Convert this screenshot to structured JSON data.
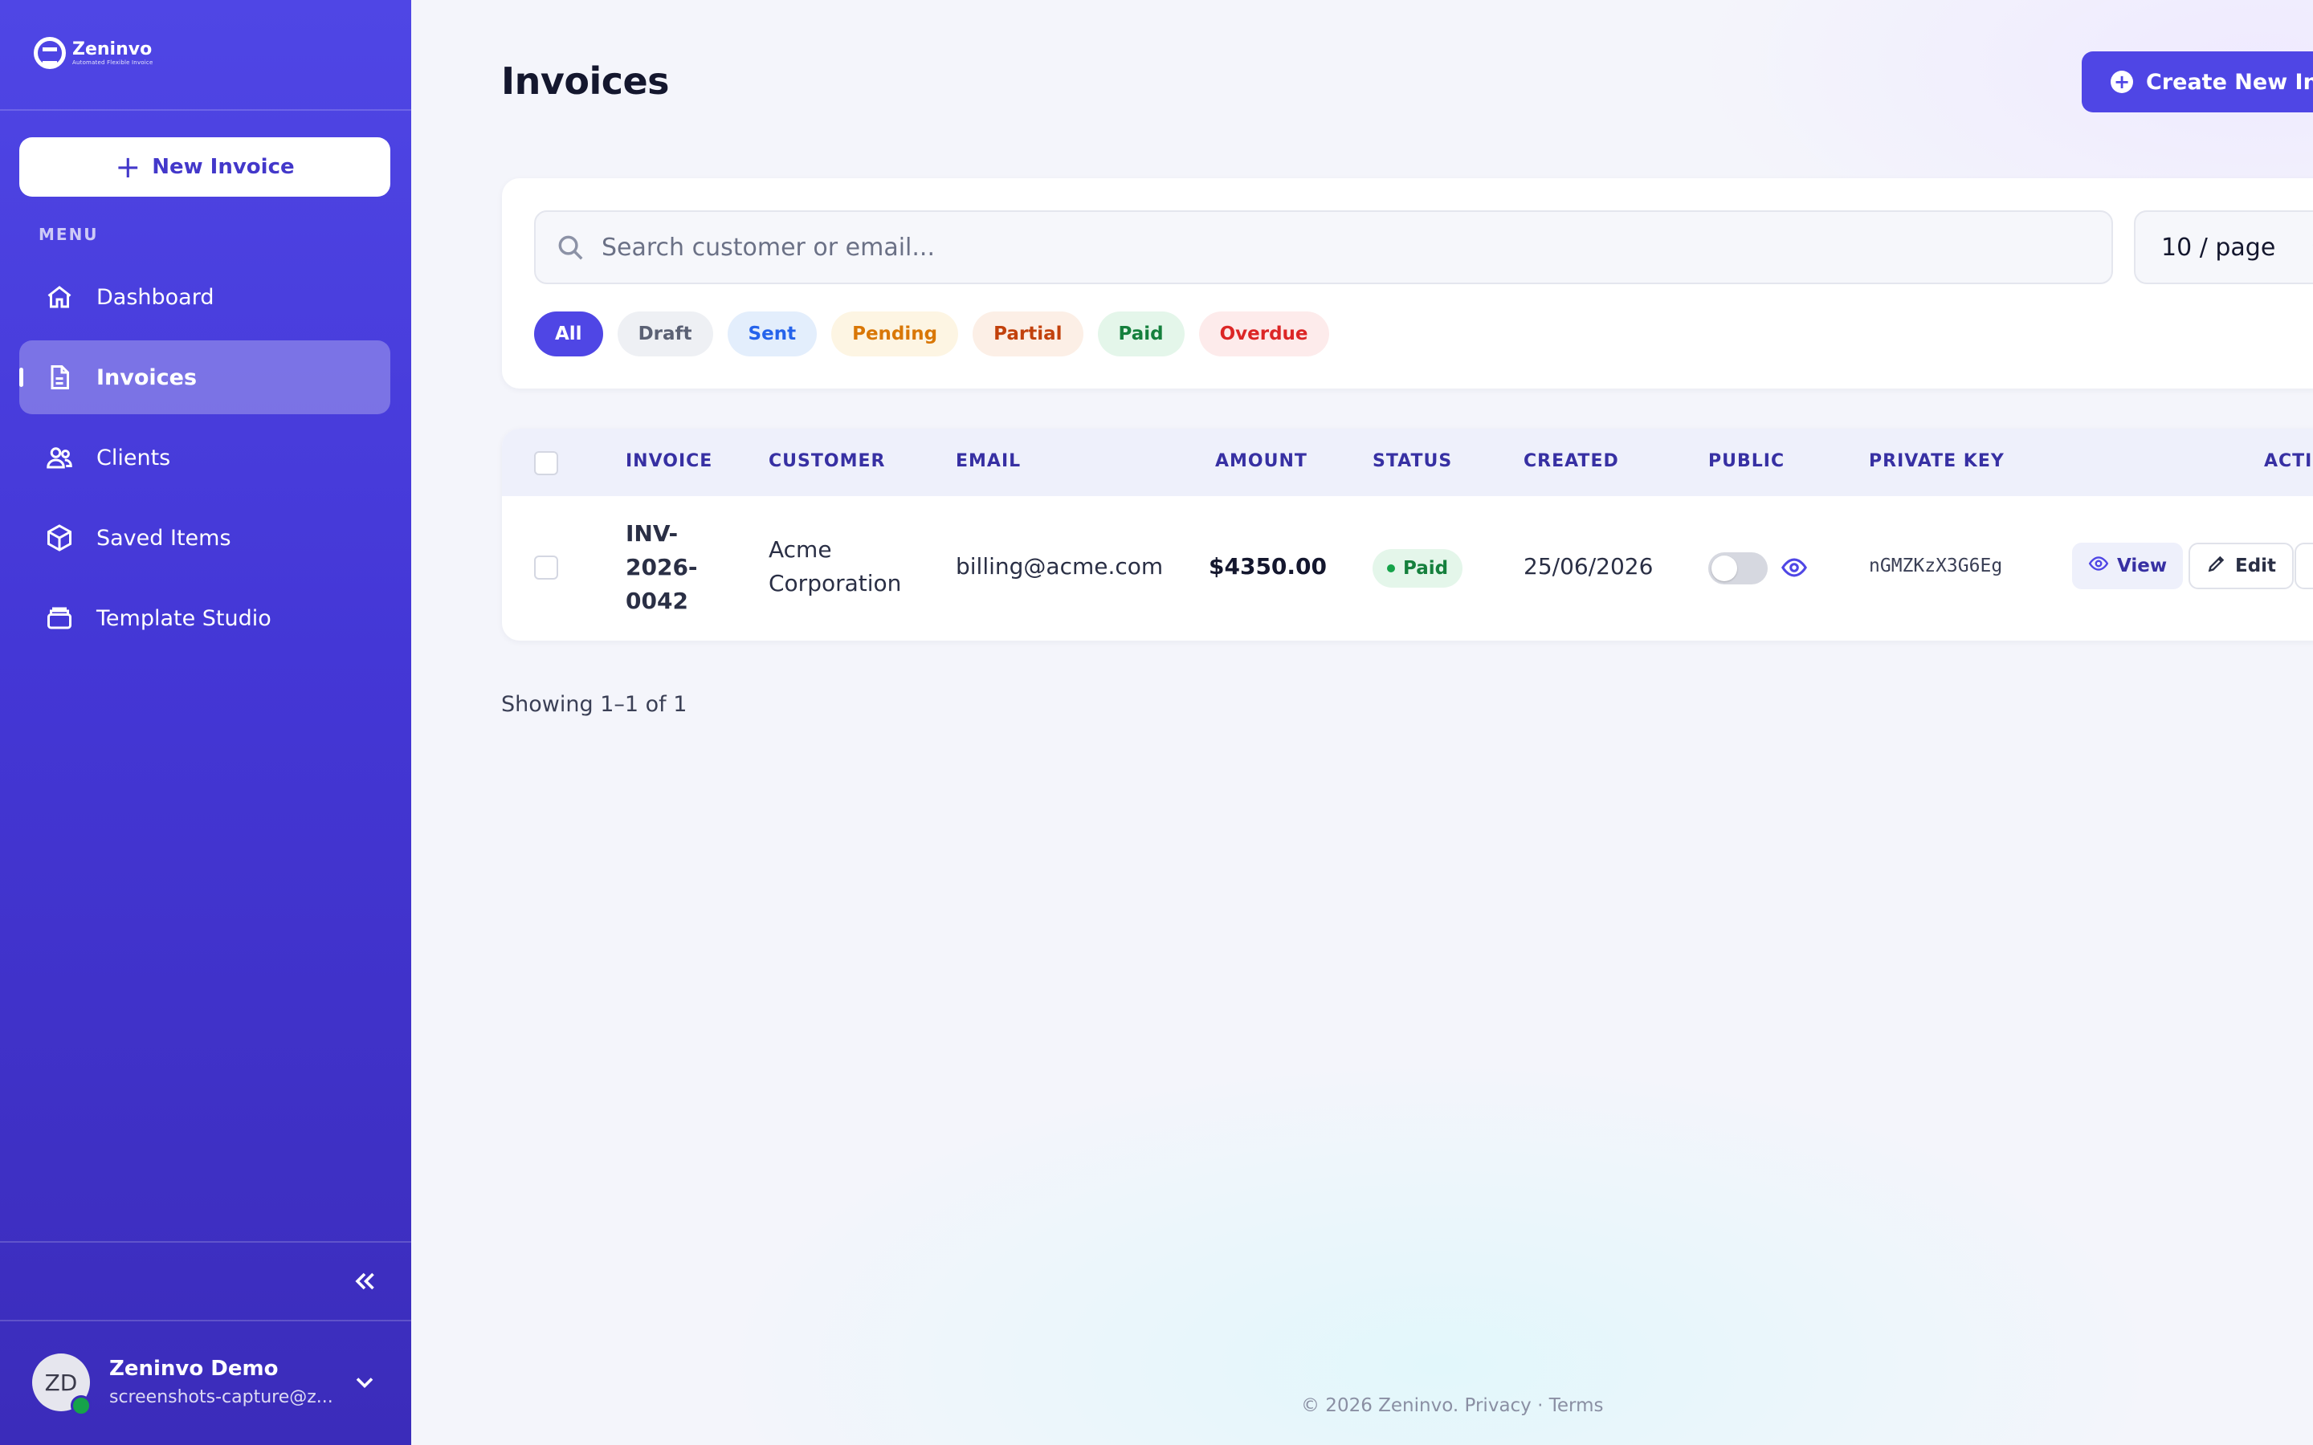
{
  "brand": {
    "name": "Zeninvo",
    "tagline": "Automated Flexible Invoice"
  },
  "sidebar": {
    "new_invoice_label": "New Invoice",
    "menu_label": "MENU",
    "items": [
      {
        "label": "Dashboard",
        "icon": "home-icon"
      },
      {
        "label": "Invoices",
        "icon": "document-icon",
        "active": true
      },
      {
        "label": "Clients",
        "icon": "users-icon"
      },
      {
        "label": "Saved Items",
        "icon": "box-icon"
      },
      {
        "label": "Template Studio",
        "icon": "template-icon"
      }
    ],
    "collapse_icon": "double-chevron-left-icon"
  },
  "user": {
    "initials": "ZD",
    "name": "Zeninvo Demo",
    "email": "screenshots-capture@z..."
  },
  "header": {
    "title": "Invoices",
    "create_label": "Create New Invoice"
  },
  "search": {
    "placeholder": "Search customer or email...",
    "page_size": "10 / page"
  },
  "filters": [
    "All",
    "Draft",
    "Sent",
    "Pending",
    "Partial",
    "Paid",
    "Overdue"
  ],
  "table": {
    "columns": [
      "INVOICE",
      "CUSTOMER",
      "EMAIL",
      "AMOUNT",
      "STATUS",
      "CREATED",
      "PUBLIC",
      "PRIVATE KEY",
      "ACTIONS"
    ],
    "rows": [
      {
        "invoice_lines": [
          "INV-",
          "2026-",
          "0042"
        ],
        "customer_lines": [
          "Acme",
          "Corporation"
        ],
        "email": "billing@acme.com",
        "amount": "$4350.00",
        "status": "Paid",
        "created": "25/06/2026",
        "public": false,
        "private_key": "nGMZKzX3G6Eg",
        "view_label": "View",
        "edit_label": "Edit"
      }
    ]
  },
  "pagination": {
    "showing": "Showing 1–1 of 1"
  },
  "footer": {
    "copyright": "© 2026 Zeninvo.",
    "privacy": "Privacy",
    "separator": "·",
    "terms": "Terms"
  },
  "colors": {
    "brand": "#4f46e5",
    "sidebar": "#4437d6",
    "paid": "#15803d",
    "overdue": "#dc2626",
    "pending": "#d97706"
  }
}
